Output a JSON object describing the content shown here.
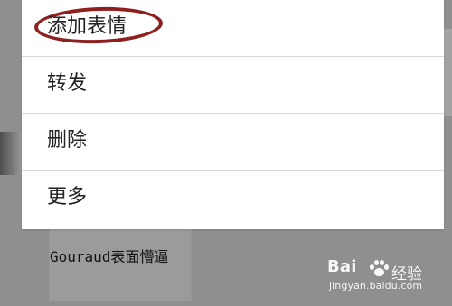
{
  "menu": {
    "items": [
      {
        "label": "添加表情"
      },
      {
        "label": "转发"
      },
      {
        "label": "删除"
      },
      {
        "label": "更多"
      }
    ]
  },
  "background": {
    "meme_text": "Gouraud表面懵逼"
  },
  "watermark": {
    "brand": "Bai",
    "suffix": "经验",
    "url": "jingyan.baidu.com"
  },
  "colors": {
    "overlay": "#8f8f8f",
    "menu_bg": "#ffffff",
    "divider": "#d8d8d8",
    "highlight": "#8f2020"
  },
  "icons": {
    "paw": "baidu-paw-icon"
  }
}
